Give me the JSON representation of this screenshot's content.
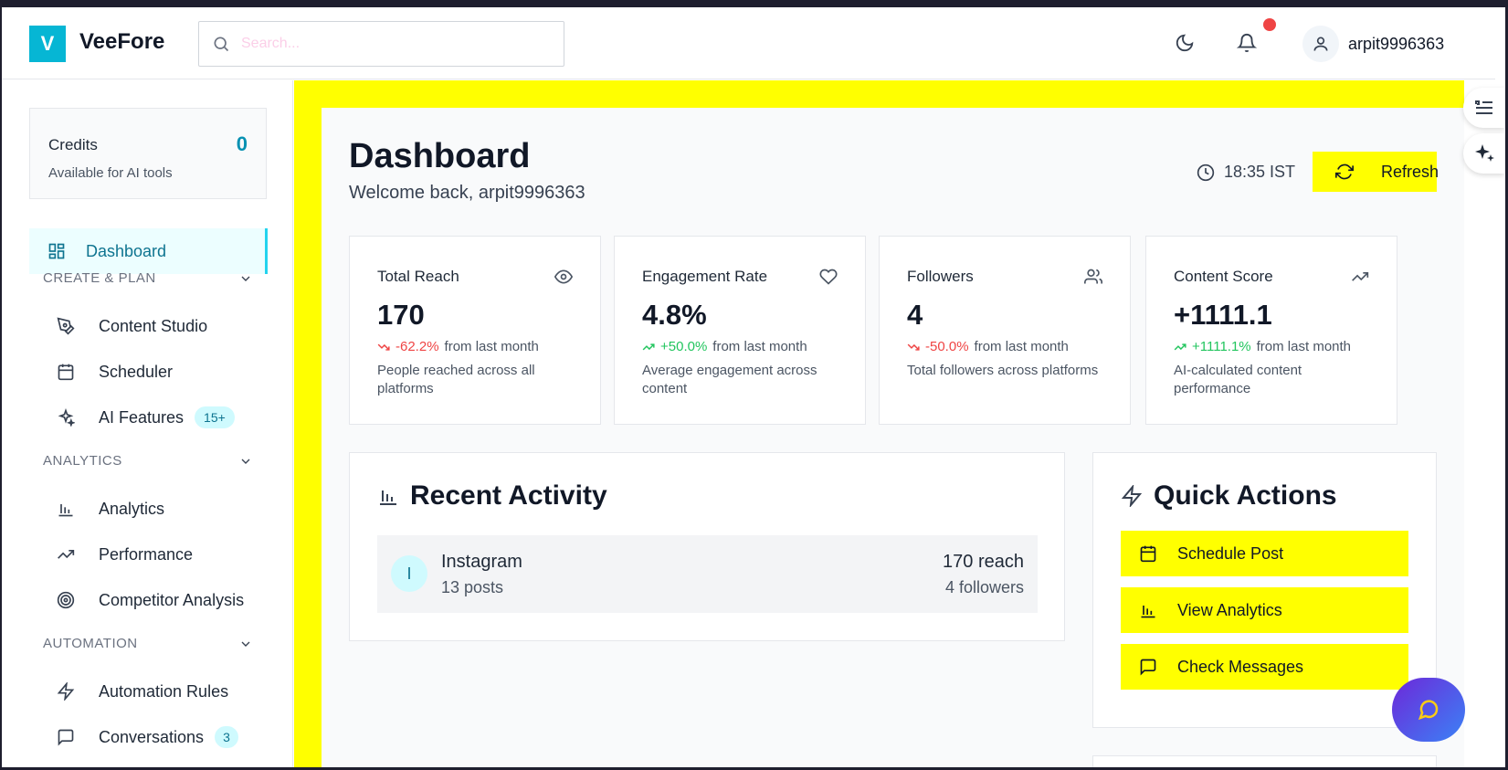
{
  "app": {
    "logo_letter": "V",
    "name": "VeeFore"
  },
  "header": {
    "search_placeholder": "Search...",
    "username": "arpit9996363"
  },
  "sidebar": {
    "credits": {
      "label": "Credits",
      "value": "0",
      "subtitle": "Available for AI tools"
    },
    "active_item": "Dashboard",
    "sections": {
      "create_plan": {
        "title": "CREATE & PLAN",
        "items": [
          {
            "label": "Content Studio",
            "icon": "pen-tool-icon"
          },
          {
            "label": "Scheduler",
            "icon": "calendar-icon"
          },
          {
            "label": "AI Features",
            "icon": "sparkles-icon",
            "badge": "15+"
          }
        ]
      },
      "analytics": {
        "title": "ANALYTICS",
        "items": [
          {
            "label": "Analytics",
            "icon": "bar-chart-icon"
          },
          {
            "label": "Performance",
            "icon": "trending-up-icon"
          },
          {
            "label": "Competitor Analysis",
            "icon": "target-icon"
          }
        ]
      },
      "automation": {
        "title": "AUTOMATION",
        "items": [
          {
            "label": "Automation Rules",
            "icon": "zap-icon"
          },
          {
            "label": "Conversations",
            "icon": "message-square-icon",
            "badge": "3"
          }
        ]
      }
    }
  },
  "main": {
    "title": "Dashboard",
    "welcome": "Welcome back, arpit9996363",
    "time": "18:35 IST",
    "refresh_label": "Refresh",
    "stats": [
      {
        "title": "Total Reach",
        "value": "170",
        "change": "-62.2%",
        "direction": "down",
        "from": "from last month",
        "desc": "People reached across all platforms",
        "icon": "eye-icon"
      },
      {
        "title": "Engagement Rate",
        "value": "4.8%",
        "change": "+50.0%",
        "direction": "up",
        "from": "from last month",
        "desc": "Average engagement across content",
        "icon": "heart-icon"
      },
      {
        "title": "Followers",
        "value": "4",
        "change": "-50.0%",
        "direction": "down",
        "from": "from last month",
        "desc": "Total followers across platforms",
        "icon": "users-icon"
      },
      {
        "title": "Content Score",
        "value": "+1111.1",
        "change": "+1111.1%",
        "direction": "up",
        "from": "from last month",
        "desc": "AI-calculated content performance",
        "icon": "trending-up-icon"
      }
    ],
    "recent_activity": {
      "title": "Recent Activity",
      "items": [
        {
          "avatar": "I",
          "platform": "Instagram",
          "posts": "13 posts",
          "reach": "170 reach",
          "followers": "4 followers"
        }
      ]
    },
    "quick_actions": {
      "title": "Quick Actions",
      "buttons": [
        {
          "label": "Schedule Post",
          "icon": "calendar-icon"
        },
        {
          "label": "View Analytics",
          "icon": "bar-chart-icon"
        },
        {
          "label": "Check Messages",
          "icon": "message-square-icon"
        }
      ]
    }
  },
  "colors": {
    "accent": "#06b6d4",
    "highlight": "#ffff00",
    "down": "#ef4444",
    "up": "#22c55e",
    "notification": "#ef4444"
  }
}
